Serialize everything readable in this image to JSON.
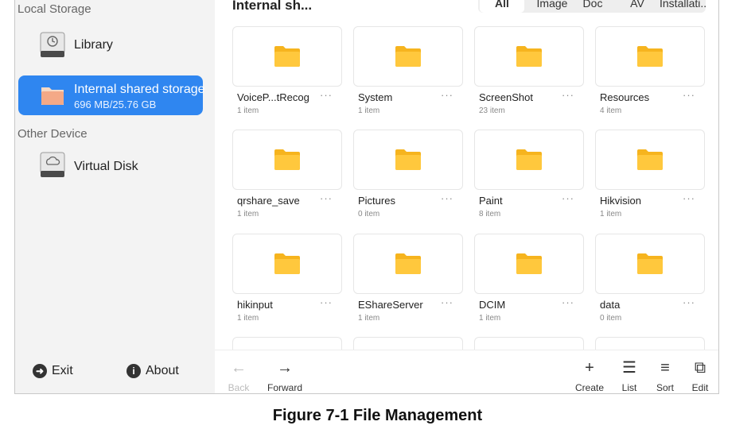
{
  "sidebar": {
    "local_title": "Local Storage",
    "library_label": "Library",
    "internal": {
      "label": "Internal shared storage",
      "usage": "696 MB/25.76 GB"
    },
    "other_title": "Other Device",
    "virtual_disk_label": "Virtual Disk",
    "exit_label": "Exit",
    "about_label": "About"
  },
  "main": {
    "path_title": "Internal sh...",
    "filter_tabs": [
      "All",
      "Image",
      "Doc",
      "AV",
      "Installati..."
    ],
    "active_filter": "All",
    "folders": [
      {
        "name": "VoiceP...tRecog",
        "count": "1 item"
      },
      {
        "name": "System",
        "count": "1 item"
      },
      {
        "name": "ScreenShot",
        "count": "23 item"
      },
      {
        "name": "Resources",
        "count": "4 item"
      },
      {
        "name": "qrshare_save",
        "count": "1 item"
      },
      {
        "name": "Pictures",
        "count": "0 item"
      },
      {
        "name": "Paint",
        "count": "8 item"
      },
      {
        "name": "Hikvision",
        "count": "1 item"
      },
      {
        "name": "hikinput",
        "count": "1 item"
      },
      {
        "name": "EShareServer",
        "count": "1 item"
      },
      {
        "name": "DCIM",
        "count": "1 item"
      },
      {
        "name": "data",
        "count": "0 item"
      }
    ],
    "more_glyph": "···"
  },
  "toolbar": {
    "back_label": "Back",
    "forward_label": "Forward",
    "create_label": "Create",
    "list_label": "List",
    "sort_label": "Sort",
    "edit_label": "Edit"
  },
  "icons": {
    "library": "library-drive-icon",
    "internal": "folder-storage-icon",
    "virtual_disk": "cloud-drive-icon",
    "folder": "folder-icon",
    "exit": "exit-icon",
    "about": "info-icon"
  },
  "colors": {
    "accent": "#2f86f0",
    "folder": "#ffc83d",
    "folder_dark": "#f6b41e"
  },
  "caption": "Figure 7-1 File Management"
}
